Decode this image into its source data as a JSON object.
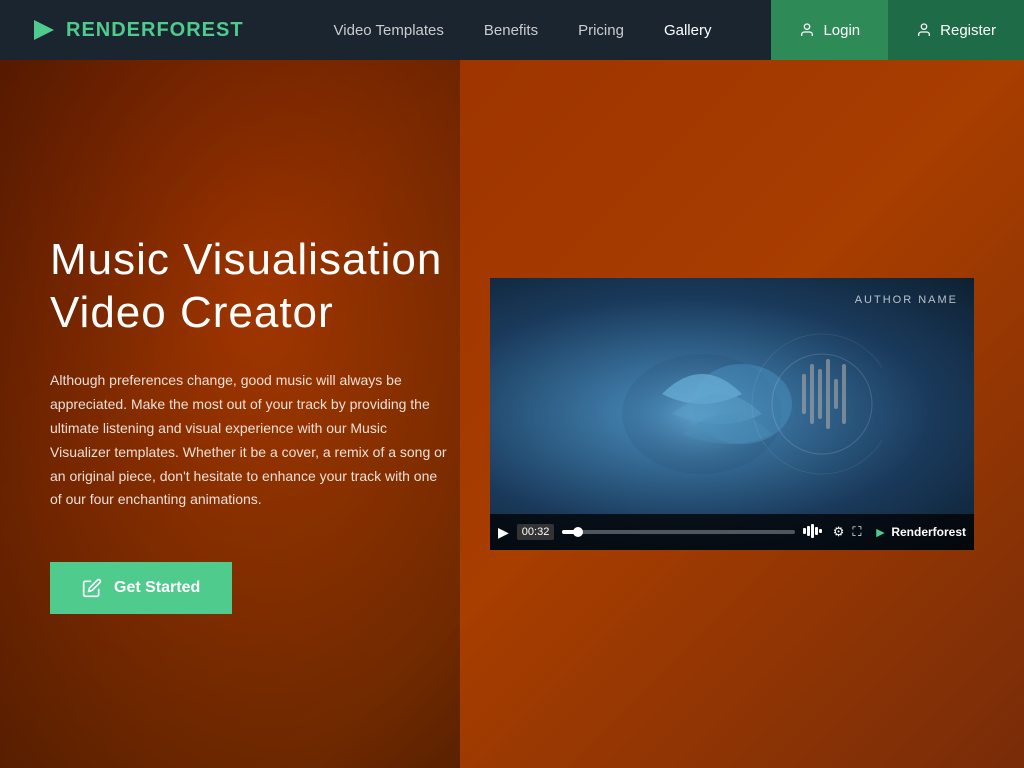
{
  "nav": {
    "logo_render": "RENDER",
    "logo_forest": "FOREST",
    "links": [
      {
        "id": "video-templates",
        "label": "Video Templates",
        "active": false
      },
      {
        "id": "benefits",
        "label": "Benefits",
        "active": false
      },
      {
        "id": "pricing",
        "label": "Pricing",
        "active": false
      },
      {
        "id": "gallery",
        "label": "Gallery",
        "active": true
      }
    ],
    "login_label": "Login",
    "register_label": "Register"
  },
  "hero": {
    "title": "Music Visualisation\nVideo Creator",
    "description": "Although preferences change, good music will always be appreciated. Make the most out of your track by providing the ultimate listening and visual experience with our Music Visualizer templates. Whether it be a cover, a remix of a song or an original piece, don't hesitate to enhance your track with one of our four enchanting animations.",
    "cta_label": "Get Started"
  },
  "video": {
    "author_label": "AUTHOR NAME",
    "time": "00:32",
    "progress_percent": 8,
    "brand_label": "Renderforest"
  }
}
